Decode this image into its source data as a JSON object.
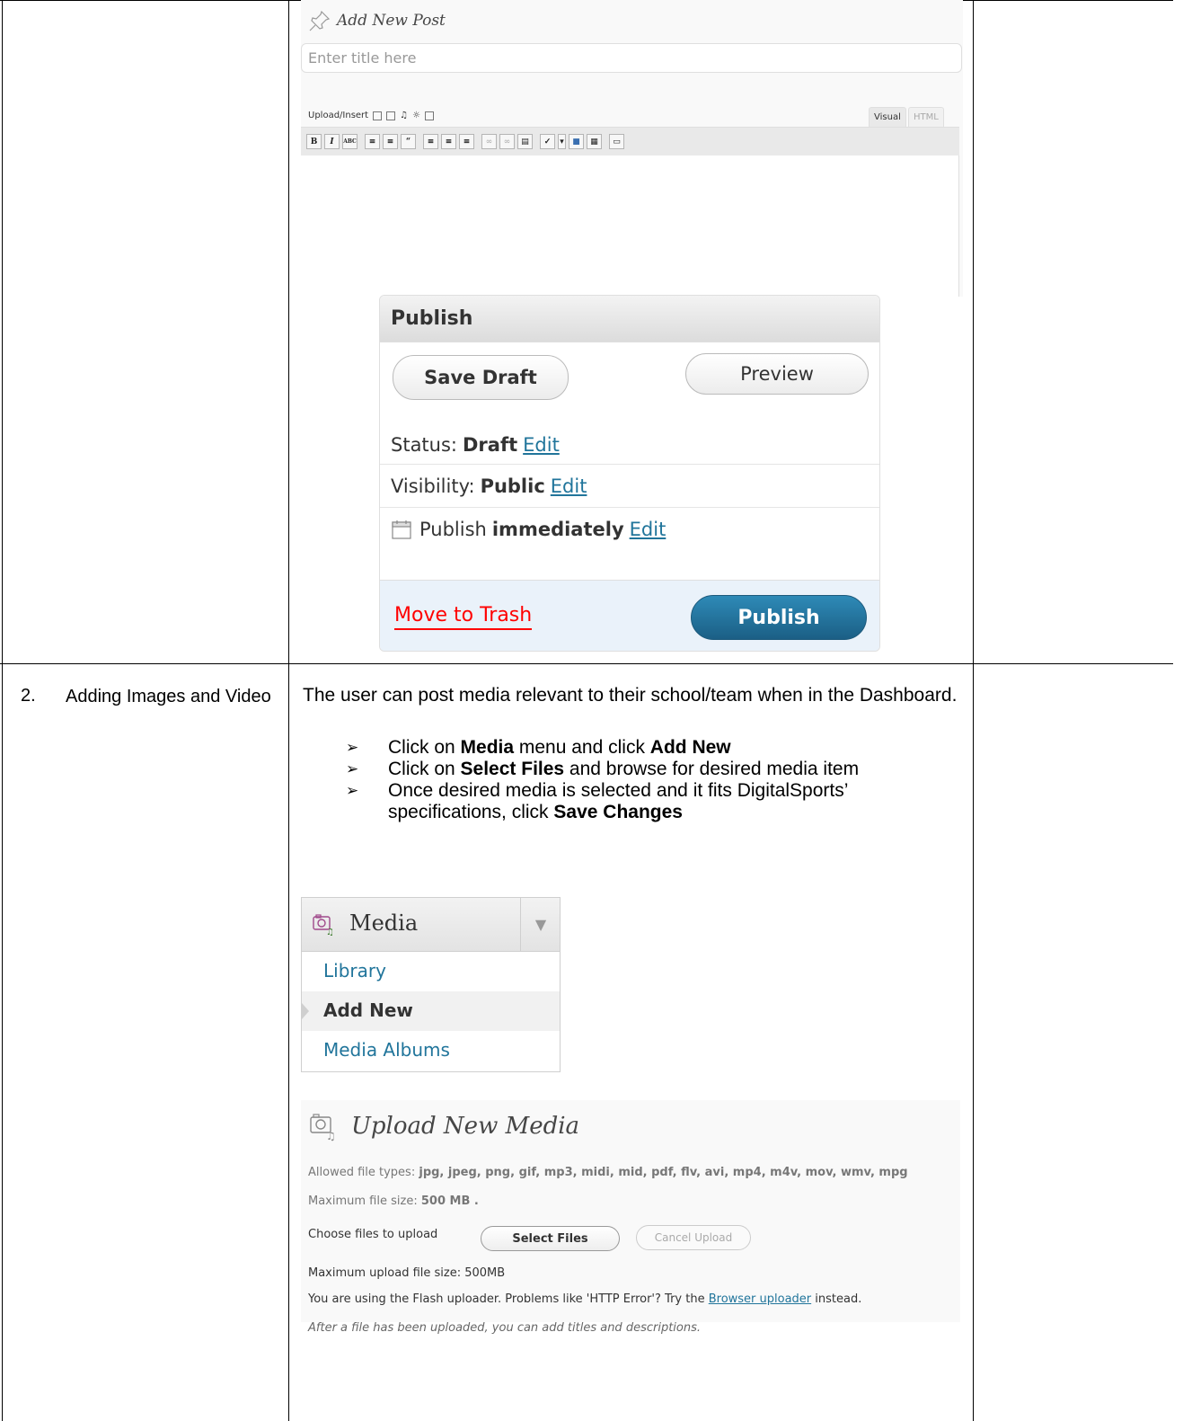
{
  "post_editor": {
    "header_title": "Add New Post",
    "title_placeholder": "Enter title here",
    "upload_insert_label": "Upload/Insert",
    "tab_visual": "Visual",
    "tab_html": "HTML",
    "toolbar_buttons": [
      "B",
      "I",
      "ABC",
      "ul",
      "ol",
      "quote",
      "align-left",
      "align-center",
      "align-right",
      "link",
      "unlink",
      "more",
      "spell",
      "fullscreen",
      "kitchen-sink"
    ]
  },
  "publish_box": {
    "title": "Publish",
    "save_draft": "Save Draft",
    "preview": "Preview",
    "status_label": "Status:",
    "status_value": "Draft",
    "visibility_label": "Visibility:",
    "visibility_value": "Public",
    "publish_label": "Publish",
    "publish_value": "immediately",
    "edit_link": "Edit",
    "move_to_trash": "Move to Trash",
    "publish_button": "Publish"
  },
  "row2": {
    "number": "2.",
    "label": "Adding Images and Video",
    "intro": "The user can post media relevant to their school/team when in the Dashboard.",
    "bullets": [
      {
        "pre": "Click on ",
        "b1": "Media",
        "mid": " menu and click ",
        "b2": "Add New",
        "post": ""
      },
      {
        "pre": "Click on ",
        "b1": "Select Files",
        "mid": " and browse for desired media item",
        "b2": "",
        "post": ""
      },
      {
        "pre": "Once desired media is selected and it fits DigitalSports’ specifications, click ",
        "b1": "Save Changes",
        "mid": "",
        "b2": "",
        "post": ""
      }
    ]
  },
  "media_menu": {
    "title": "Media",
    "items": [
      "Library",
      "Add New",
      "Media Albums"
    ]
  },
  "upload_media": {
    "title": "Upload New Media",
    "allowed_label": "Allowed file types:",
    "allowed_value": "jpg, jpeg, png, gif, mp3, midi, mid, pdf, flv, avi, mp4, m4v, mov, wmv, mpg",
    "max_size_label": "Maximum file size:",
    "max_size_value": "500 MB .",
    "choose_label": "Choose files to upload",
    "select_files": "Select Files",
    "cancel_upload": "Cancel Upload",
    "max_upload": "Maximum upload file size: 500MB",
    "flash_pre": "You are using the Flash uploader. Problems like 'HTTP Error'? Try the",
    "flash_link": "Browser uploader",
    "flash_post": "instead.",
    "after_note": "After a file has been uploaded, you can add titles and descriptions."
  },
  "colors": {
    "link": "#21759b",
    "trash": "#ff0000",
    "publish_button": "#21759b",
    "document_mark": "#c00000"
  }
}
